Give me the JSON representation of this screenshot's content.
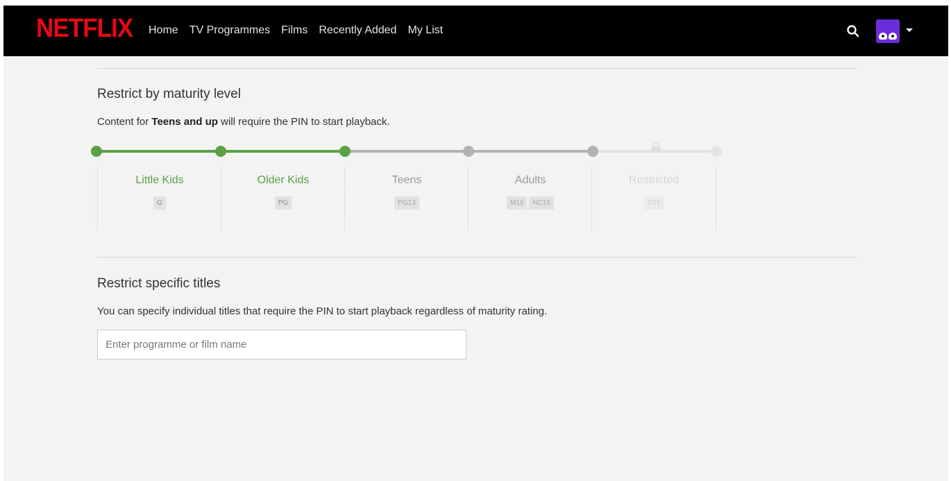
{
  "brand": {
    "logo": "NETFLIX",
    "color": "#e50914"
  },
  "nav": [
    "Home",
    "TV Programmes",
    "Films",
    "Recently Added",
    "My List"
  ],
  "header_icons": {
    "search": "search-icon",
    "profile": "avatar",
    "menu": "caret-down-icon"
  },
  "maturity": {
    "heading": "Restrict by maturity level",
    "desc_prefix": "Content for ",
    "desc_bold": "Teens and up",
    "desc_suffix": " will require the PIN to start playback.",
    "selected_index": 2,
    "levels": [
      {
        "name": "Little Kids",
        "ratings": [
          "G"
        ],
        "state": "allowed"
      },
      {
        "name": "Older Kids",
        "ratings": [
          "PG"
        ],
        "state": "allowed"
      },
      {
        "name": "Teens",
        "ratings": [
          "PG13"
        ],
        "state": "restricted"
      },
      {
        "name": "Adults",
        "ratings": [
          "M18",
          "NC16"
        ],
        "state": "restricted"
      },
      {
        "name": "Restricted",
        "ratings": [
          "R21"
        ],
        "state": "locked"
      }
    ],
    "colors": {
      "allowed": "#5aa144",
      "restricted": "#999999",
      "locked": "#e4e4e4"
    }
  },
  "specific": {
    "heading": "Restrict specific titles",
    "desc": "You can specify individual titles that require the PIN to start playback regardless of maturity rating.",
    "placeholder": "Enter programme or film name"
  }
}
